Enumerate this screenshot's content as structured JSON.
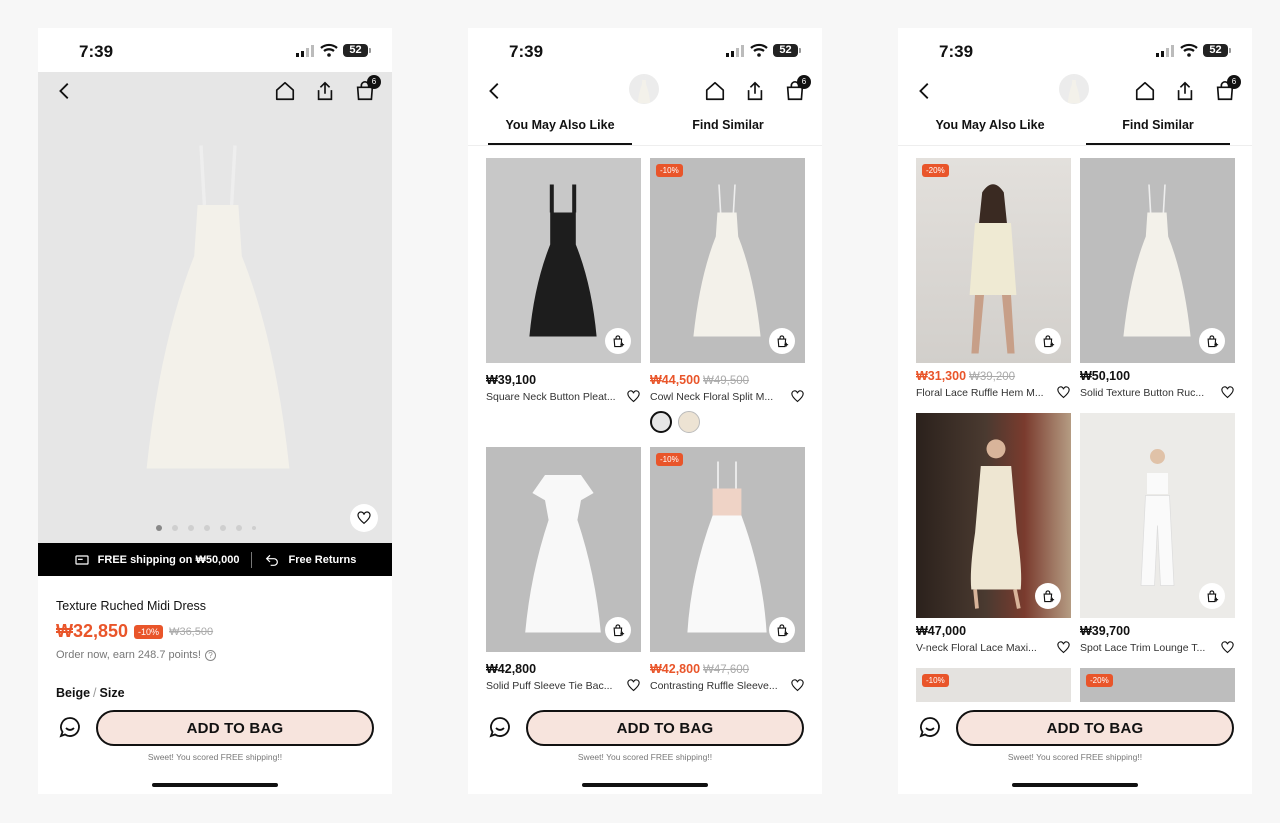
{
  "status": {
    "time": "7:39",
    "battery": "52"
  },
  "cart_count": "6",
  "screen1": {
    "product_name": "Texture Ruched Midi Dress",
    "price": "₩32,850",
    "discount": "-10%",
    "old_price": "₩36,500",
    "points": "Order now, earn 248.7 points!",
    "qmark": "?",
    "shipping": "FREE shipping on ₩50,000",
    "returns": "Free Returns",
    "variant_color": "Beige",
    "variant_size": "Size",
    "slash": "/"
  },
  "tabs": {
    "tab1": "You May Also Like",
    "tab2": "Find Similar"
  },
  "screen2": {
    "products": [
      {
        "price": "₩39,100",
        "title": "Square Neck Button Pleat...",
        "badge": "",
        "old_price": ""
      },
      {
        "price": "₩44,500",
        "title": "Cowl Neck Floral Split M...",
        "badge": "-10%",
        "old_price": "₩49,500"
      },
      {
        "price": "₩42,800",
        "title": "Solid Puff Sleeve Tie Bac...",
        "badge": "",
        "old_price": ""
      },
      {
        "price": "₩42,800",
        "title": "Contrasting Ruffle Sleeve...",
        "badge": "-10%",
        "old_price": "₩47,600"
      }
    ]
  },
  "screen3": {
    "products": [
      {
        "price": "₩31,300",
        "title": "Floral Lace Ruffle Hem M...",
        "badge": "-20%",
        "old_price": "₩39,200"
      },
      {
        "price": "₩50,100",
        "title": "Solid Texture Button Ruc...",
        "badge": "",
        "old_price": ""
      },
      {
        "price": "₩47,000",
        "title": "V-neck Floral Lace Maxi...",
        "badge": "",
        "old_price": ""
      },
      {
        "price": "₩39,700",
        "title": "Spot Lace Trim Lounge T...",
        "badge": "",
        "old_price": ""
      }
    ],
    "peek_badges": [
      "-10%",
      "-20%"
    ]
  },
  "bottom": {
    "add_to_bag": "ADD TO BAG",
    "sweet": "Sweet! You scored FREE shipping!!"
  },
  "colors": {
    "accent": "#e9552a",
    "button_bg": "#f7e4dd"
  }
}
